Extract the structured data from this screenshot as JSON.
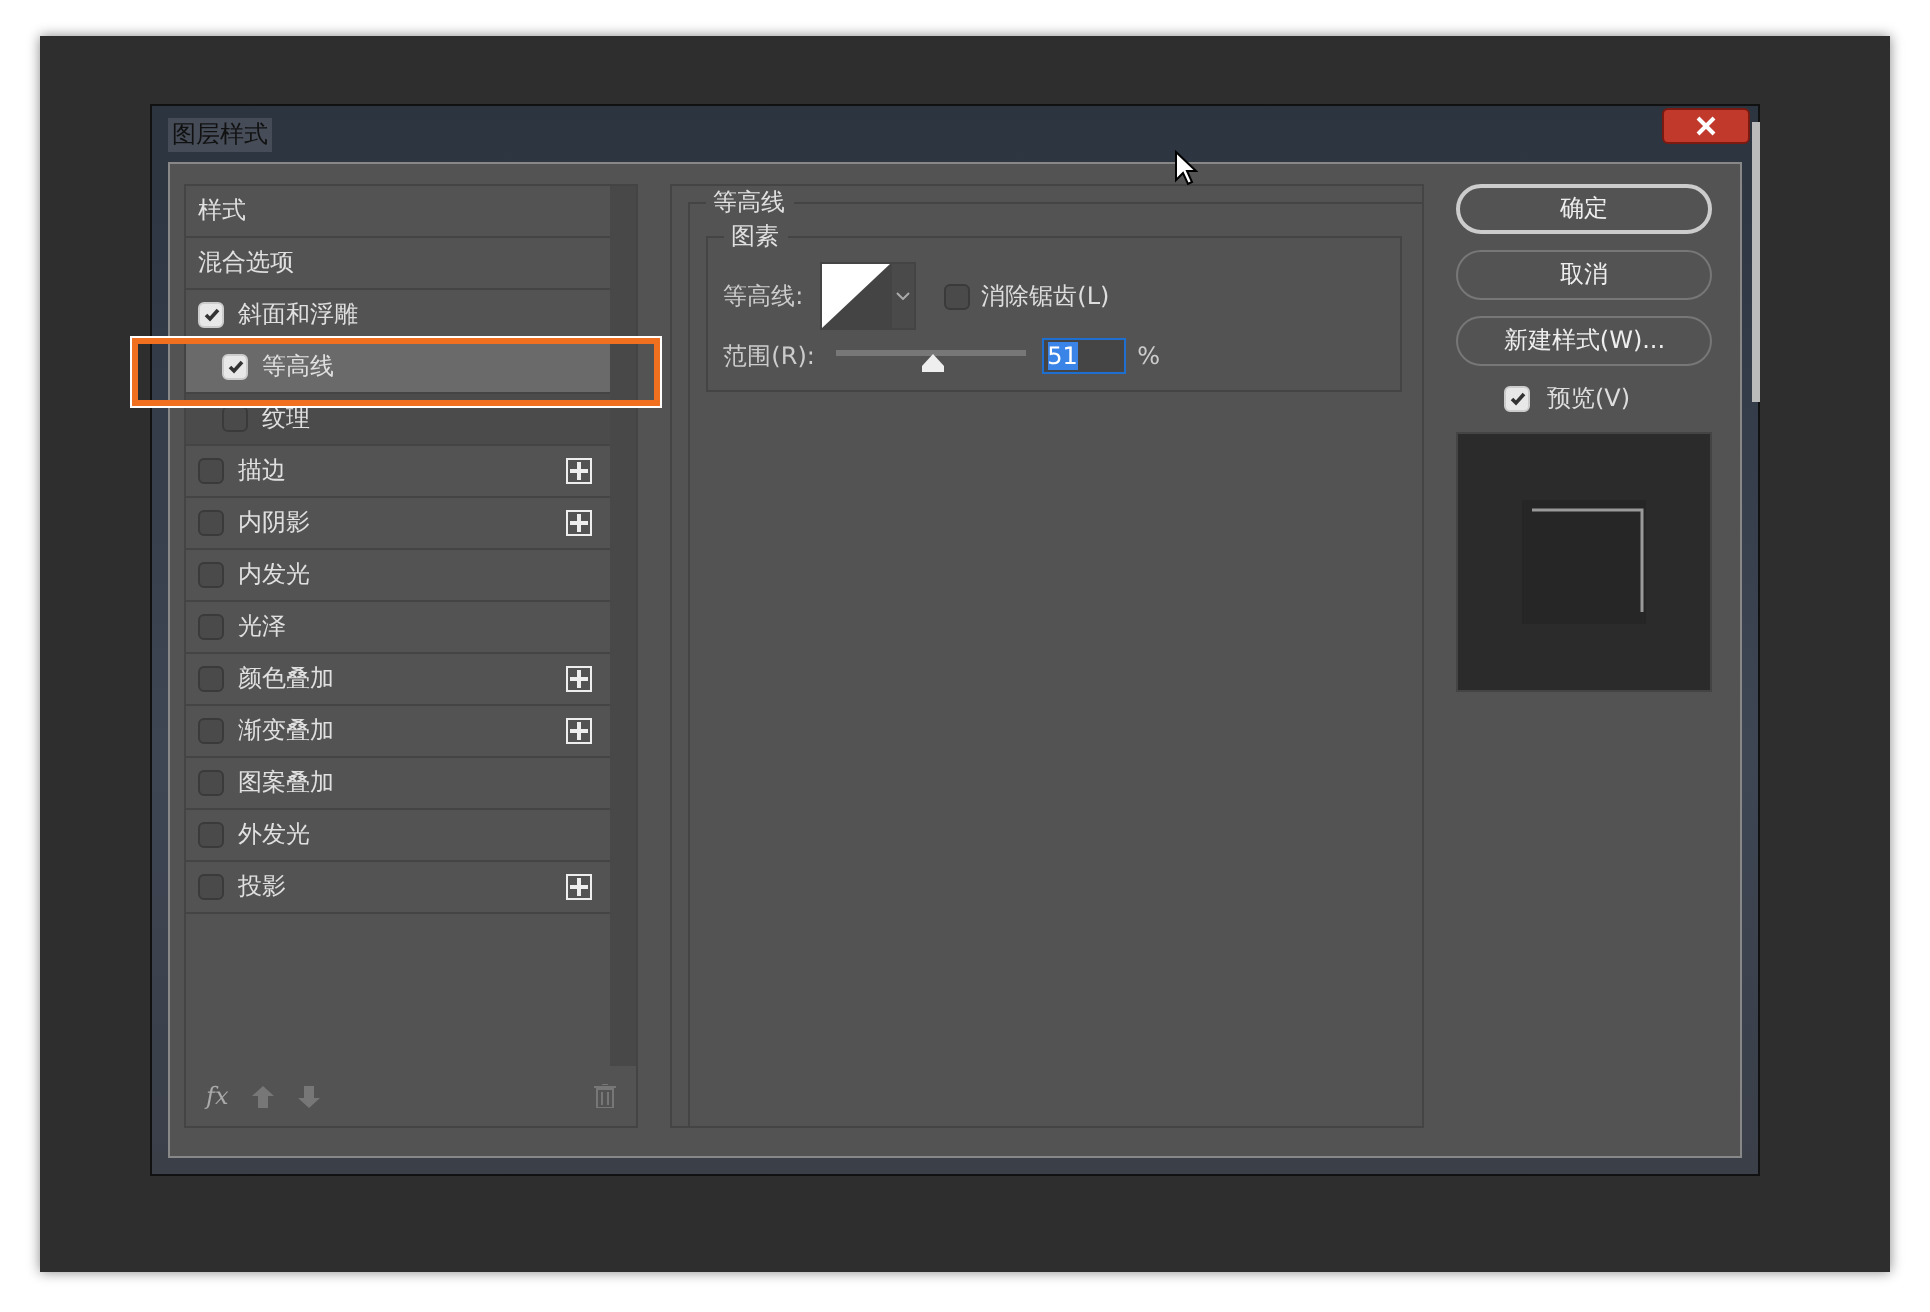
{
  "window": {
    "title": "图层样式"
  },
  "sidebar": {
    "items": [
      {
        "kind": "header",
        "label": "样式",
        "selected": false
      },
      {
        "kind": "header",
        "label": "混合选项",
        "selected": false
      },
      {
        "kind": "effect",
        "label": "斜面和浮雕",
        "checked": true,
        "selected": false,
        "addable": false,
        "children": [
          {
            "kind": "effect",
            "label": "等高线",
            "checked": true,
            "selected": true,
            "addable": false
          },
          {
            "kind": "effect",
            "label": "纹理",
            "checked": false,
            "selected": false,
            "addable": false
          }
        ]
      },
      {
        "kind": "effect",
        "label": "描边",
        "checked": false,
        "selected": false,
        "addable": true
      },
      {
        "kind": "effect",
        "label": "内阴影",
        "checked": false,
        "selected": false,
        "addable": true
      },
      {
        "kind": "effect",
        "label": "内发光",
        "checked": false,
        "selected": false,
        "addable": false
      },
      {
        "kind": "effect",
        "label": "光泽",
        "checked": false,
        "selected": false,
        "addable": false
      },
      {
        "kind": "effect",
        "label": "颜色叠加",
        "checked": false,
        "selected": false,
        "addable": true
      },
      {
        "kind": "effect",
        "label": "渐变叠加",
        "checked": false,
        "selected": false,
        "addable": true
      },
      {
        "kind": "effect",
        "label": "图案叠加",
        "checked": false,
        "selected": false,
        "addable": false
      },
      {
        "kind": "effect",
        "label": "外发光",
        "checked": false,
        "selected": false,
        "addable": false
      },
      {
        "kind": "effect",
        "label": "投影",
        "checked": false,
        "selected": false,
        "addable": true
      }
    ],
    "footer": {
      "fx": "fx"
    }
  },
  "panel": {
    "title": "等高线",
    "group": "图素",
    "contour_label": "等高线:",
    "antialias": {
      "label": "消除锯齿(L)",
      "checked": false
    },
    "range": {
      "label": "范围(R):",
      "level": 0.51,
      "value": "51",
      "unit": "%"
    }
  },
  "buttons": [
    {
      "label": "确定",
      "default": true
    },
    {
      "label": "取消",
      "default": false
    },
    {
      "label": "新建样式(W)...",
      "default": false
    }
  ],
  "preview": {
    "label": "预览(V)",
    "checked": true
  }
}
